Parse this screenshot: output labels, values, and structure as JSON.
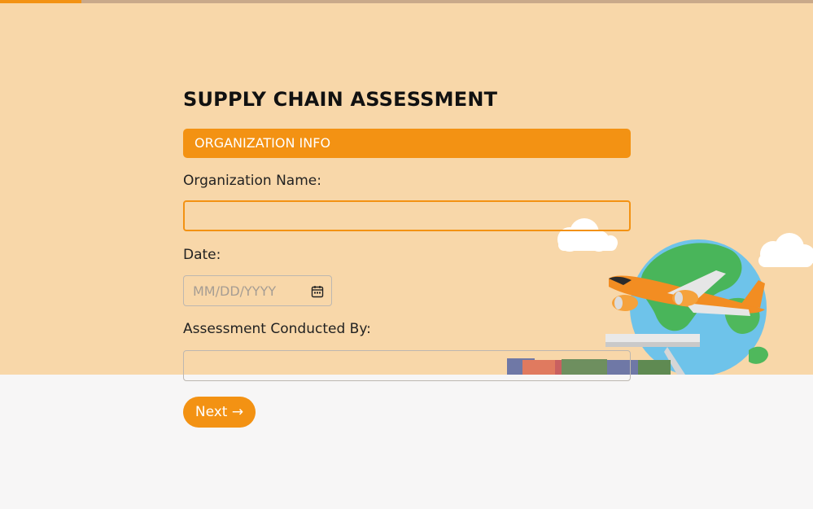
{
  "progress": {
    "value_percent": 10
  },
  "form": {
    "title": "SUPPLY CHAIN ASSESSMENT",
    "section_header": "ORGANIZATION INFO",
    "fields": {
      "organization_name": {
        "label": "Organization Name:",
        "value": ""
      },
      "date": {
        "label": "Date:",
        "placeholder": "MM/DD/YYYY",
        "value": ""
      },
      "conducted_by": {
        "label": "Assessment Conducted By:",
        "value": ""
      }
    },
    "next_label": "Next →"
  },
  "colors": {
    "accent": "#f39213",
    "hero_background": "#f8d7a9",
    "page_background": "#f7f6f6"
  },
  "icons": {
    "date_picker": "calendar-icon",
    "illustration": "globe-airplane-ship-illustration"
  }
}
